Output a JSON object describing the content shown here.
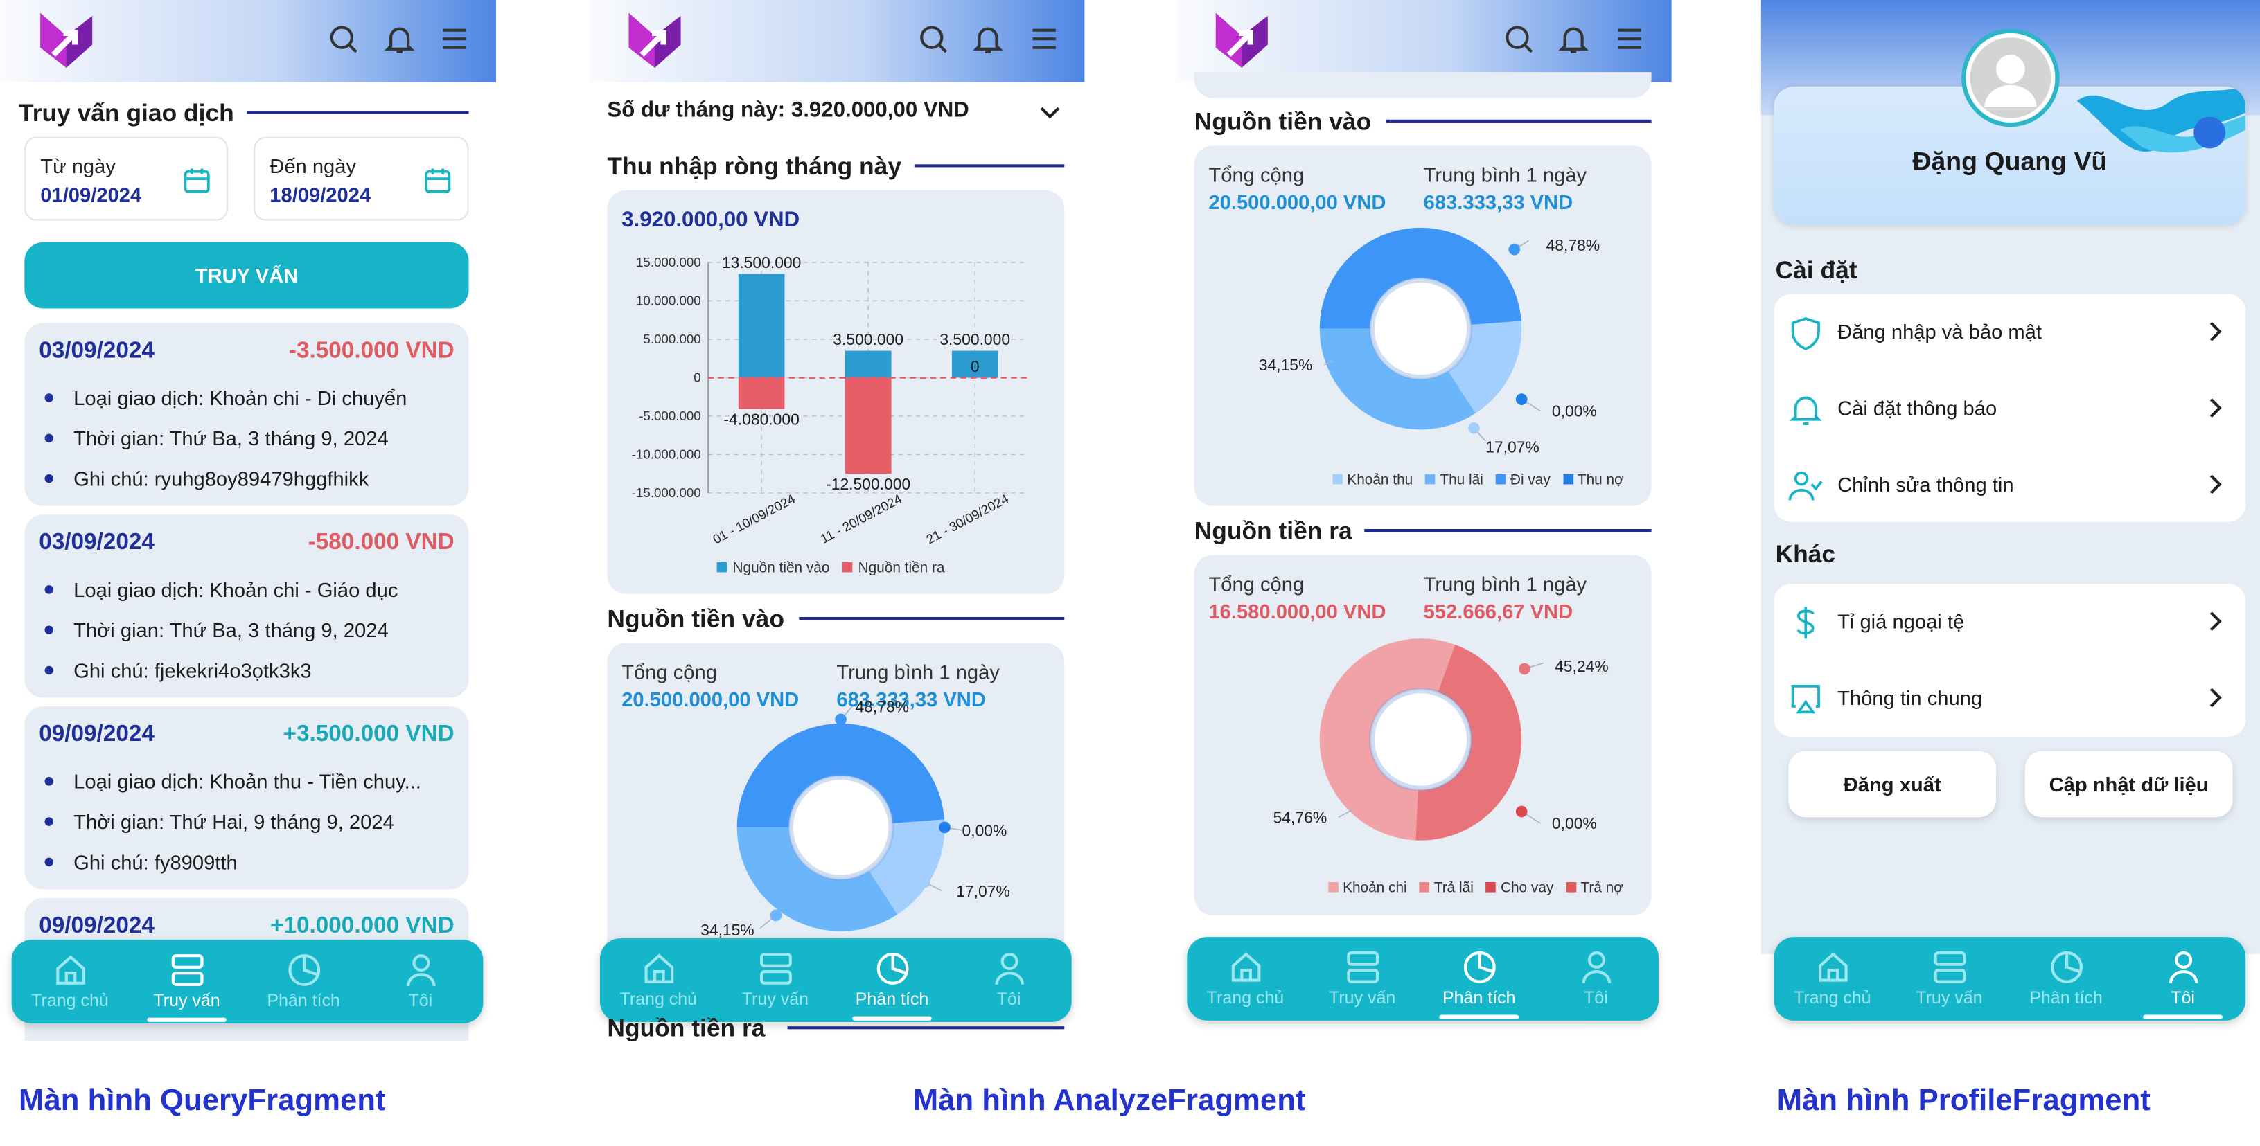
{
  "query": {
    "title": "Truy vấn giao dịch",
    "from_label": "Từ ngày",
    "from_value": "01/09/2024",
    "to_label": "Đến ngày",
    "to_value": "18/09/2024",
    "search_button": "TRUY VẤN",
    "transactions": [
      {
        "date": "03/09/2024",
        "amount": "-3.500.000 VND",
        "type": "Loại giao dịch: Khoản chi - Di chuyển",
        "time": "Thời gian: Thứ Ba, 3 tháng 9, 2024",
        "note": "Ghi chú: ryuhg8oy89479hggfhikk"
      },
      {
        "date": "03/09/2024",
        "amount": "-580.000 VND",
        "type": "Loại giao dịch: Khoản chi - Giáo dục",
        "time": "Thời gian: Thứ Ba, 3 tháng 9, 2024",
        "note": "Ghi chú: fjekekri4o3ọtk3k3"
      },
      {
        "date": "09/09/2024",
        "amount": "+3.500.000 VND",
        "type": "Loại giao dịch: Khoản thu - Tiền chuy...",
        "time": "Thời gian: Thứ Hai, 9 tháng 9, 2024",
        "note": "Ghi chú: fy8909tth"
      },
      {
        "date": "09/09/2024",
        "amount": "+10.000.000 VND",
        "type": "",
        "time": "",
        "note": ""
      }
    ],
    "caption": "Màn hình QueryFragment"
  },
  "analyze": {
    "balance": "Số dư tháng này: 3.920.000,00 VND",
    "net_title": "Thu nhập ròng tháng này",
    "net_value": "3.920.000,00 VND",
    "income_title": "Nguồn tiền vào",
    "total_label": "Tổng cộng",
    "avg_label": "Trung bình 1 ngày",
    "income_total": "20.500.000,00 VND",
    "income_avg": "683.333,33 VND",
    "expense_title": "Nguồn tiền ra",
    "expense_total": "16.580.000,00 VND",
    "expense_avg": "552.666,67 VND",
    "caption": "Màn hình AnalyzeFragment"
  },
  "chart_data": [
    {
      "type": "bar",
      "categories": [
        "01 - 10/09/2024",
        "11 - 20/09/2024",
        "21 - 30/09/2024"
      ],
      "series": [
        {
          "name": "Nguồn tiền vào",
          "values": [
            13500000,
            3500000,
            3500000
          ],
          "color": "#2b9bd0"
        },
        {
          "name": "Nguồn tiền ra",
          "values": [
            -4080000,
            -12500000,
            0
          ],
          "color": "#e45d67"
        }
      ],
      "value_labels": [
        [
          "13.500.000",
          "3.500.000",
          "3.500.000"
        ],
        [
          "-4.080.000",
          "-12.500.000",
          "0"
        ]
      ],
      "yticks": [
        "15.000.000",
        "10.000.000",
        "5.000.000",
        "0",
        "-5.000.000",
        "-10.000.000",
        "-15.000.000"
      ],
      "ylim": [
        -15000000,
        15000000
      ],
      "grid": true,
      "legend": "bottom"
    },
    {
      "type": "pie",
      "labels": [
        "Khoản thu",
        "Thu lãi",
        "Đi vay",
        "Thu nợ"
      ],
      "values": [
        34.15,
        17.07,
        0.0,
        48.78
      ],
      "pct_labels": [
        "34,15%",
        "17,07%",
        "0,00%",
        "48,78%"
      ],
      "colors": [
        "#6bb6fb",
        "#a2cffd",
        "#1f7ee8",
        "#3c95f7"
      ],
      "legend": "bottom"
    },
    {
      "type": "pie",
      "labels": [
        "Khoản chi",
        "Trả lãi",
        "Cho vay",
        "Trả nợ"
      ],
      "values": [
        54.76,
        0.0,
        0.0,
        45.24
      ],
      "pct_labels": [
        "54,76%",
        "",
        "0,00%",
        "45,24%"
      ],
      "colors": [
        "#f0a2a6",
        "#ea8589",
        "#d9474f",
        "#e87479"
      ],
      "legend": "bottom"
    }
  ],
  "profile": {
    "name": "Đặng Quang Vũ",
    "settings_title": "Cài đặt",
    "settings": [
      "Đăng nhập và bảo mật",
      "Cài đặt thông báo",
      "Chỉnh sửa thông tin"
    ],
    "other_title": "Khác",
    "other": [
      "Tỉ giá ngoại tệ",
      "Thông tin chung"
    ],
    "logout": "Đăng xuất",
    "update": "Cập nhật dữ liệu",
    "caption": "Màn hình ProfileFragment"
  },
  "nav": [
    "Trang chủ",
    "Truy vấn",
    "Phân tích",
    "Tôi"
  ],
  "colors": {
    "accent": "#15b6c9",
    "navy": "#1e2f9a",
    "negative": "#e05a62",
    "positive": "#17a9b8",
    "caption": "#2432cc"
  }
}
